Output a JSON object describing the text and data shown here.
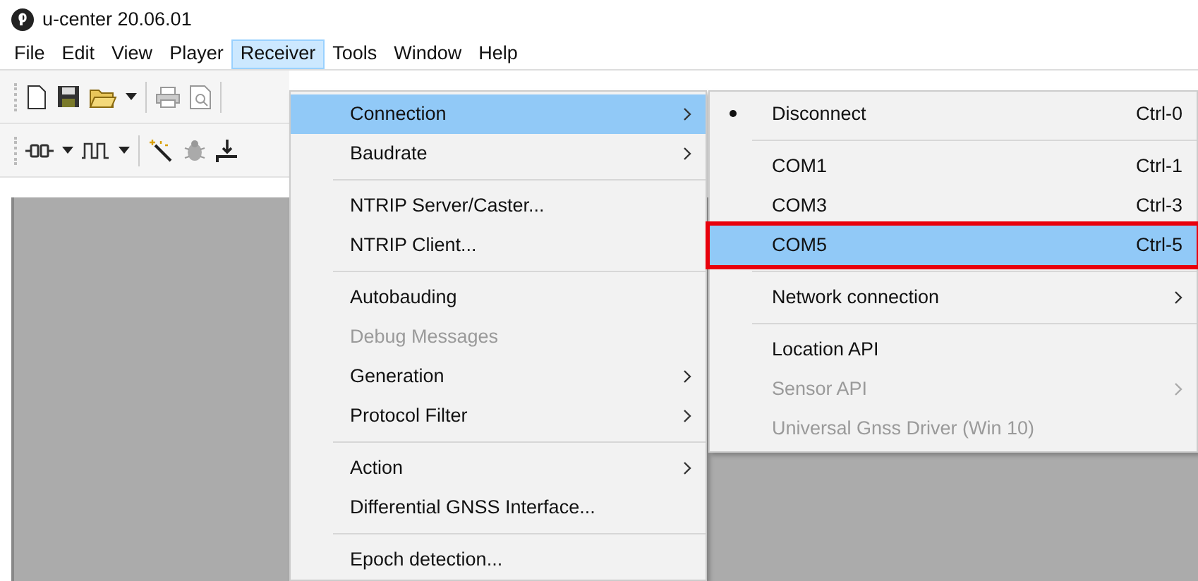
{
  "window": {
    "title": "u-center 20.06.01"
  },
  "menubar": [
    {
      "label": "File",
      "selected": false
    },
    {
      "label": "Edit",
      "selected": false
    },
    {
      "label": "View",
      "selected": false
    },
    {
      "label": "Player",
      "selected": false
    },
    {
      "label": "Receiver",
      "selected": true
    },
    {
      "label": "Tools",
      "selected": false
    },
    {
      "label": "Window",
      "selected": false
    },
    {
      "label": "Help",
      "selected": false
    }
  ],
  "receiver_menu": [
    {
      "kind": "item",
      "label": "Connection",
      "submenu": true,
      "selected": true,
      "disabled": false
    },
    {
      "kind": "item",
      "label": "Baudrate",
      "submenu": true,
      "selected": false,
      "disabled": false
    },
    {
      "kind": "separator"
    },
    {
      "kind": "item",
      "label": "NTRIP Server/Caster...",
      "submenu": false,
      "selected": false,
      "disabled": false
    },
    {
      "kind": "item",
      "label": "NTRIP Client...",
      "submenu": false,
      "selected": false,
      "disabled": false
    },
    {
      "kind": "separator"
    },
    {
      "kind": "item",
      "label": "Autobauding",
      "submenu": false,
      "selected": false,
      "disabled": false
    },
    {
      "kind": "item",
      "label": "Debug Messages",
      "submenu": false,
      "selected": false,
      "disabled": true
    },
    {
      "kind": "item",
      "label": "Generation",
      "submenu": true,
      "selected": false,
      "disabled": false
    },
    {
      "kind": "item",
      "label": "Protocol Filter",
      "submenu": true,
      "selected": false,
      "disabled": false
    },
    {
      "kind": "separator"
    },
    {
      "kind": "item",
      "label": "Action",
      "submenu": true,
      "selected": false,
      "disabled": false
    },
    {
      "kind": "item",
      "label": "Differential GNSS Interface...",
      "submenu": false,
      "selected": false,
      "disabled": false
    },
    {
      "kind": "separator"
    },
    {
      "kind": "item",
      "label": "Epoch detection...",
      "submenu": false,
      "selected": false,
      "disabled": false
    }
  ],
  "connection_menu": [
    {
      "kind": "item",
      "label": "Disconnect",
      "shortcut": "Ctrl-0",
      "checked": true,
      "submenu": false,
      "selected": false,
      "disabled": false,
      "outlined": false
    },
    {
      "kind": "separator"
    },
    {
      "kind": "item",
      "label": "COM1",
      "shortcut": "Ctrl-1",
      "checked": false,
      "submenu": false,
      "selected": false,
      "disabled": false,
      "outlined": false
    },
    {
      "kind": "item",
      "label": "COM3",
      "shortcut": "Ctrl-3",
      "checked": false,
      "submenu": false,
      "selected": false,
      "disabled": false,
      "outlined": false
    },
    {
      "kind": "item",
      "label": "COM5",
      "shortcut": "Ctrl-5",
      "checked": false,
      "submenu": false,
      "selected": true,
      "disabled": false,
      "outlined": true
    },
    {
      "kind": "separator"
    },
    {
      "kind": "item",
      "label": "Network connection",
      "checked": false,
      "submenu": true,
      "selected": false,
      "disabled": false,
      "outlined": false
    },
    {
      "kind": "separator"
    },
    {
      "kind": "item",
      "label": "Location API",
      "checked": false,
      "submenu": false,
      "selected": false,
      "disabled": false,
      "outlined": false
    },
    {
      "kind": "item",
      "label": "Sensor API",
      "checked": false,
      "submenu": true,
      "selected": false,
      "disabled": true,
      "outlined": false
    },
    {
      "kind": "item",
      "label": "Universal Gnss Driver (Win 10)",
      "checked": false,
      "submenu": false,
      "selected": false,
      "disabled": true,
      "outlined": false
    }
  ]
}
